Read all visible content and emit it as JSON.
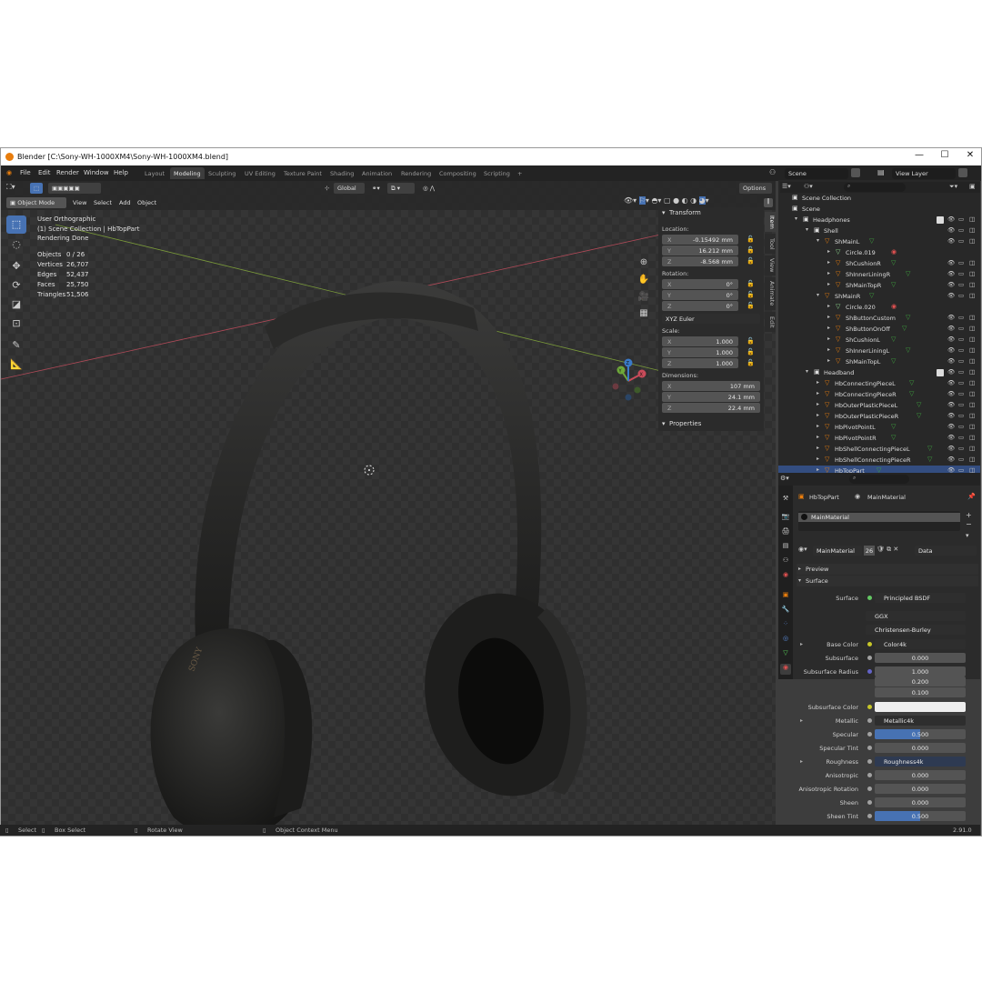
{
  "window": {
    "title": "Blender [C:\\Sony-WH-1000XM4\\Sony-WH-1000XM4.blend]",
    "minimize": "—",
    "maximize": "☐",
    "close": "✕"
  },
  "menu": [
    "File",
    "Edit",
    "Render",
    "Window",
    "Help"
  ],
  "workspaces": [
    "Layout",
    "Modeling",
    "Sculpting",
    "UV Editing",
    "Texture Paint",
    "Shading",
    "Animation",
    "Rendering",
    "Compositing",
    "Scripting"
  ],
  "active_workspace": "Modeling",
  "add_workspace": "+",
  "scene": {
    "name": "Scene",
    "view_layer": "View Layer"
  },
  "viewport_header": {
    "mode": "Object Mode",
    "menus": [
      "View",
      "Select",
      "Add",
      "Object"
    ],
    "orientation": "Global",
    "options": "Options"
  },
  "overlay": {
    "view_name": "User Orthographic",
    "collection": "(1) Scene Collection | HbTopPart",
    "status": "Rendering Done",
    "stats": [
      {
        "label": "Objects",
        "value": "0 / 26"
      },
      {
        "label": "Vertices",
        "value": "26,707"
      },
      {
        "label": "Edges",
        "value": "52,437"
      },
      {
        "label": "Faces",
        "value": "25,750"
      },
      {
        "label": "Triangles",
        "value": "51,506"
      }
    ]
  },
  "headphone_brand": "SONY",
  "nav_gizmo": {
    "x": "X",
    "y": "Y",
    "z": "Z"
  },
  "npanel": {
    "transform_title": "Transform",
    "location_label": "Location:",
    "location": [
      {
        "axis": "X",
        "value": "-0.15492 mm"
      },
      {
        "axis": "Y",
        "value": "16.212 mm"
      },
      {
        "axis": "Z",
        "value": "-8.568 mm"
      }
    ],
    "rotation_label": "Rotation:",
    "rotation": [
      {
        "axis": "X",
        "value": "0°"
      },
      {
        "axis": "Y",
        "value": "0°"
      },
      {
        "axis": "Z",
        "value": "0°"
      }
    ],
    "rotation_mode": "XYZ Euler",
    "scale_label": "Scale:",
    "scale": [
      {
        "axis": "X",
        "value": "1.000"
      },
      {
        "axis": "Y",
        "value": "1.000"
      },
      {
        "axis": "Z",
        "value": "1.000"
      }
    ],
    "dimensions_label": "Dimensions:",
    "dimensions": [
      {
        "axis": "X",
        "value": "107 mm"
      },
      {
        "axis": "Y",
        "value": "24.1 mm"
      },
      {
        "axis": "Z",
        "value": "22.4 mm"
      }
    ],
    "properties_title": "Properties",
    "tabs": [
      "Item",
      "Tool",
      "View",
      "Animate",
      "Edit"
    ]
  },
  "outliner": {
    "rows": [
      {
        "name": "Scene Collection",
        "level": 0
      },
      {
        "name": "Scene",
        "level": 0
      },
      {
        "name": "Headphones",
        "level": 1
      },
      {
        "name": "Shell",
        "level": 2
      },
      {
        "name": "ShMainL",
        "level": 3
      },
      {
        "name": "Circle.019",
        "level": 4
      },
      {
        "name": "ShCushionR",
        "level": 4
      },
      {
        "name": "ShInnerLiningR",
        "level": 4
      },
      {
        "name": "ShMainTopR",
        "level": 4
      },
      {
        "name": "ShMainR",
        "level": 3
      },
      {
        "name": "Circle.020",
        "level": 4
      },
      {
        "name": "ShButtonCustom",
        "level": 4
      },
      {
        "name": "ShButtonOnOff",
        "level": 4
      },
      {
        "name": "ShCushionL",
        "level": 4
      },
      {
        "name": "ShInnerLiningL",
        "level": 4
      },
      {
        "name": "ShMainTopL",
        "level": 4
      },
      {
        "name": "Headband",
        "level": 2
      },
      {
        "name": "HbConnectingPieceL",
        "level": 3
      },
      {
        "name": "HbConnectingPieceR",
        "level": 3
      },
      {
        "name": "HbOuterPlasticPieceL",
        "level": 3
      },
      {
        "name": "HbOuterPlasticPieceR",
        "level": 3
      },
      {
        "name": "HbPivotPointL",
        "level": 3
      },
      {
        "name": "HbPivotPointR",
        "level": 3
      },
      {
        "name": "HbShellConnectingPieceL",
        "level": 3
      },
      {
        "name": "HbShellConnectingPieceR",
        "level": 3
      },
      {
        "name": "HbTopPart",
        "level": 3
      }
    ]
  },
  "properties": {
    "object": "HbTopPart",
    "material": "MainMaterial",
    "slot": "MainMaterial",
    "users": "26",
    "link": "Data",
    "preview": "Preview",
    "surface_section": "Surface",
    "surface_label": "Surface",
    "surface_value": "Principled BSDF",
    "distribution": "GGX",
    "subsurface_method": "Christensen-Burley",
    "fields": [
      {
        "label": "Base Color",
        "value": "Color4k",
        "kind": "link"
      },
      {
        "label": "Subsurface",
        "value": "0.000",
        "kind": "num"
      },
      {
        "label": "Subsurface Radius",
        "value": "1.000",
        "kind": "num"
      },
      {
        "label": "",
        "value": "0.200",
        "kind": "num"
      },
      {
        "label": "",
        "value": "0.100",
        "kind": "num"
      },
      {
        "label": "Subsurface Color",
        "value": "",
        "kind": "color"
      },
      {
        "label": "Metallic",
        "value": "Metallic4k",
        "kind": "link"
      },
      {
        "label": "Specular",
        "value": "0.500",
        "kind": "slider",
        "fill": 0.5
      },
      {
        "label": "Specular Tint",
        "value": "0.000",
        "kind": "num"
      },
      {
        "label": "Roughness",
        "value": "Roughness4k",
        "kind": "link"
      },
      {
        "label": "Anisotropic",
        "value": "0.000",
        "kind": "num"
      },
      {
        "label": "Anisotropic Rotation",
        "value": "0.000",
        "kind": "num"
      },
      {
        "label": "Sheen",
        "value": "0.000",
        "kind": "num"
      },
      {
        "label": "Sheen Tint",
        "value": "0.500",
        "kind": "slider",
        "fill": 0.5
      }
    ]
  },
  "statusbar": {
    "select": "Select",
    "box_select": "Box Select",
    "rotate": "Rotate View",
    "context": "Object Context Menu",
    "version": "2.91.0"
  },
  "colors": {
    "accent": "#4772b3",
    "selected_row": "#334d80",
    "mesh_icon": "#e87d0d",
    "material_icon": "#e05050",
    "data_icon": "#3fa33f"
  }
}
